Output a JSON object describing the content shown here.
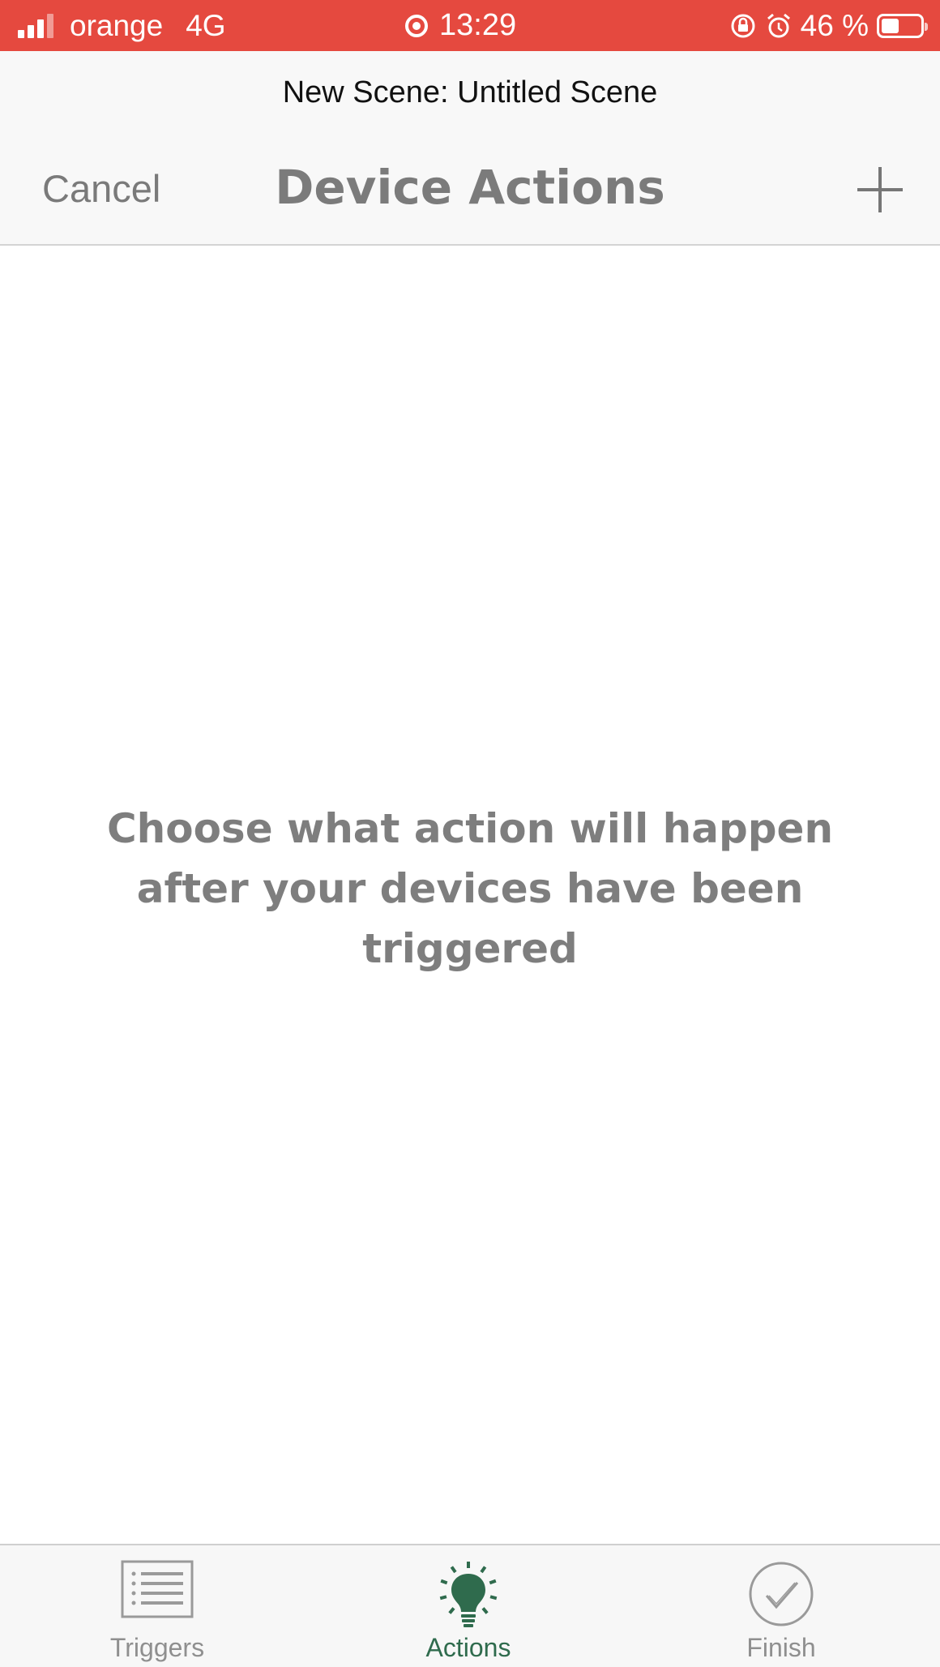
{
  "status_bar": {
    "carrier": "orange",
    "network": "4G",
    "time": "13:29",
    "battery_text": "46 %",
    "battery_level_percent": 46,
    "background_color": "#e5493f"
  },
  "header": {
    "scene_title": "New Scene: Untitled Scene",
    "cancel_label": "Cancel",
    "title": "Device Actions",
    "add_icon": "plus-icon"
  },
  "main": {
    "empty_message": "Choose what action will happen after your devices have been triggered"
  },
  "tab_bar": {
    "tabs": [
      {
        "label": "Triggers",
        "icon": "list-icon",
        "active": false
      },
      {
        "label": "Actions",
        "icon": "lightbulb-icon",
        "active": true
      },
      {
        "label": "Finish",
        "icon": "checkmark-circle-icon",
        "active": false
      }
    ],
    "active_color": "#2f6b4d",
    "inactive_color": "#8f8f8f"
  }
}
